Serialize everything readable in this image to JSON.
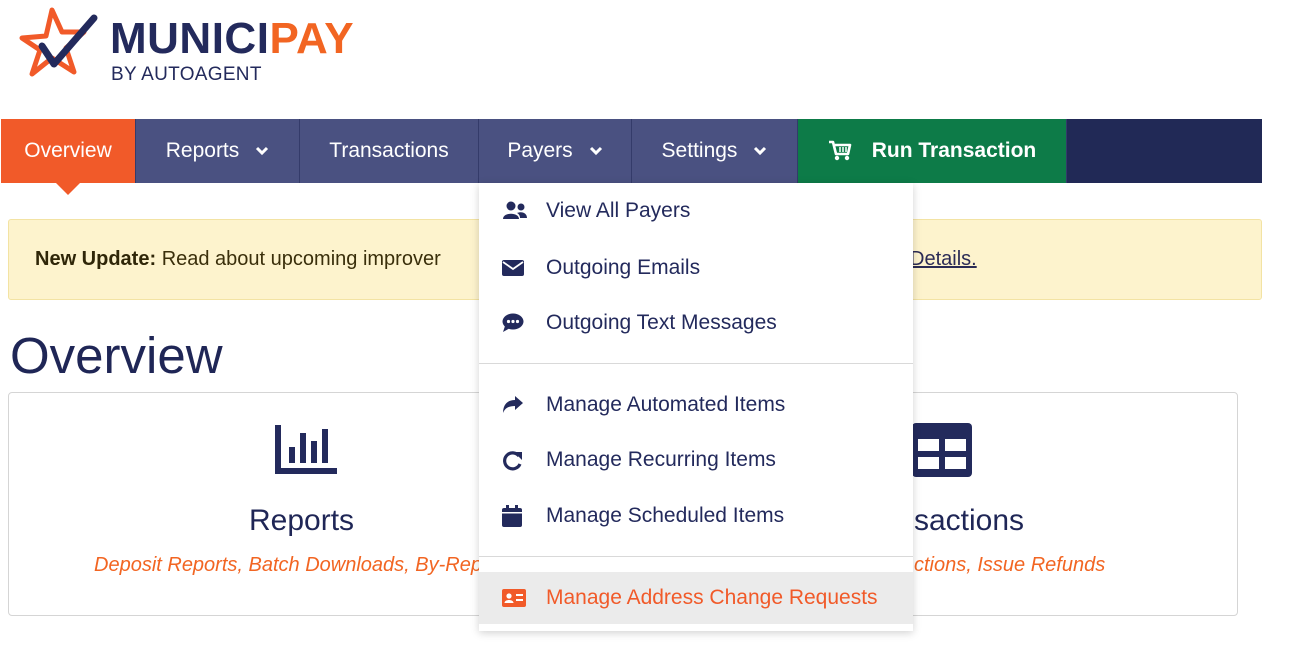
{
  "brand": {
    "name_part1": "MUNICI",
    "name_part2": "PAY",
    "tagline": "BY AUTOAGENT",
    "colors": {
      "navy": "#232a5c",
      "orange": "#f26522",
      "green": "#0d7b48"
    }
  },
  "nav": {
    "items": [
      {
        "label": "Overview",
        "active": true
      },
      {
        "label": "Reports",
        "has_dropdown": true
      },
      {
        "label": "Transactions"
      },
      {
        "label": "Payers",
        "has_dropdown": true,
        "open": true
      },
      {
        "label": "Settings",
        "has_dropdown": true
      }
    ],
    "run_transaction": {
      "label": "Run Transaction",
      "icon": "cart-icon"
    }
  },
  "alert": {
    "title": "New Update:",
    "text": "Read about upcoming improver",
    "link": "Details."
  },
  "page": {
    "title": "Overview"
  },
  "tiles": [
    {
      "title": "Reports",
      "description": "Deposit Reports, Batch Downloads, By-Rep",
      "icon": "bar-chart-icon"
    },
    {
      "title": "sactions",
      "description": "ctions, Issue Refunds",
      "icon": "table-icon"
    }
  ],
  "payers_menu": {
    "group1": [
      {
        "label": "View All Payers",
        "icon": "users-icon"
      },
      {
        "label": "Outgoing Emails",
        "icon": "envelope-icon"
      },
      {
        "label": "Outgoing Text Messages",
        "icon": "chat-icon"
      }
    ],
    "group2": [
      {
        "label": "Manage Automated Items",
        "icon": "share-arrow-icon"
      },
      {
        "label": "Manage Recurring Items",
        "icon": "redo-icon"
      },
      {
        "label": "Manage Scheduled Items",
        "icon": "calendar-icon"
      }
    ],
    "group3": [
      {
        "label": "Manage Address Change Requests",
        "icon": "address-card-icon",
        "hovered": true
      }
    ]
  }
}
